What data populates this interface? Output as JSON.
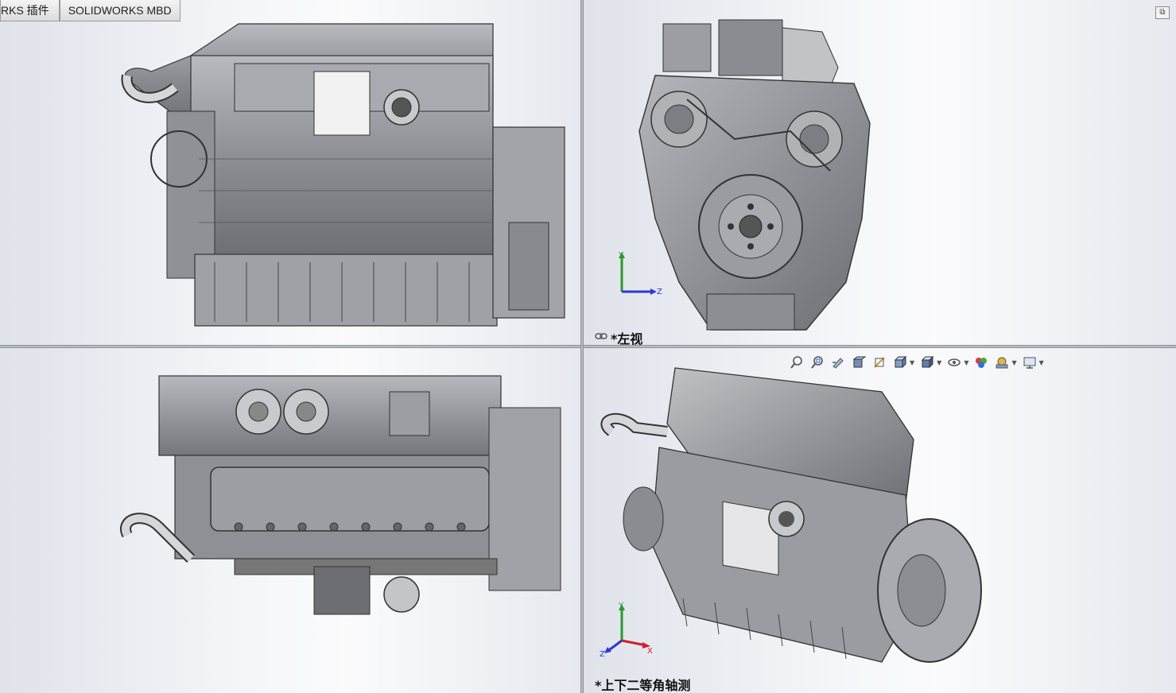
{
  "tabs": [
    {
      "label": "RKS 插件"
    },
    {
      "label": "SOLIDWORKS MBD"
    }
  ],
  "viewports": {
    "top_right": {
      "label": "*左视"
    },
    "bottom_right": {
      "label": "*上下二等角轴测"
    }
  },
  "triad": {
    "x": "X",
    "y": "Y",
    "z": "Z"
  },
  "heads_up_toolbar": [
    {
      "name": "zoom-to-fit-icon"
    },
    {
      "name": "zoom-to-area-icon"
    },
    {
      "name": "previous-view-icon"
    },
    {
      "name": "section-view-icon"
    },
    {
      "name": "dynamic-annotation-view-icon"
    },
    {
      "name": "view-orientation-icon"
    },
    {
      "name": "display-style-icon"
    },
    {
      "name": "hide-show-items-icon"
    },
    {
      "name": "edit-appearance-icon"
    },
    {
      "name": "apply-scene-icon"
    },
    {
      "name": "view-settings-icon"
    }
  ],
  "colors": {
    "axis_x": "#d0202a",
    "axis_y": "#2a9a2a",
    "axis_z": "#2a3ad0",
    "metal": "#9a9ca2"
  }
}
